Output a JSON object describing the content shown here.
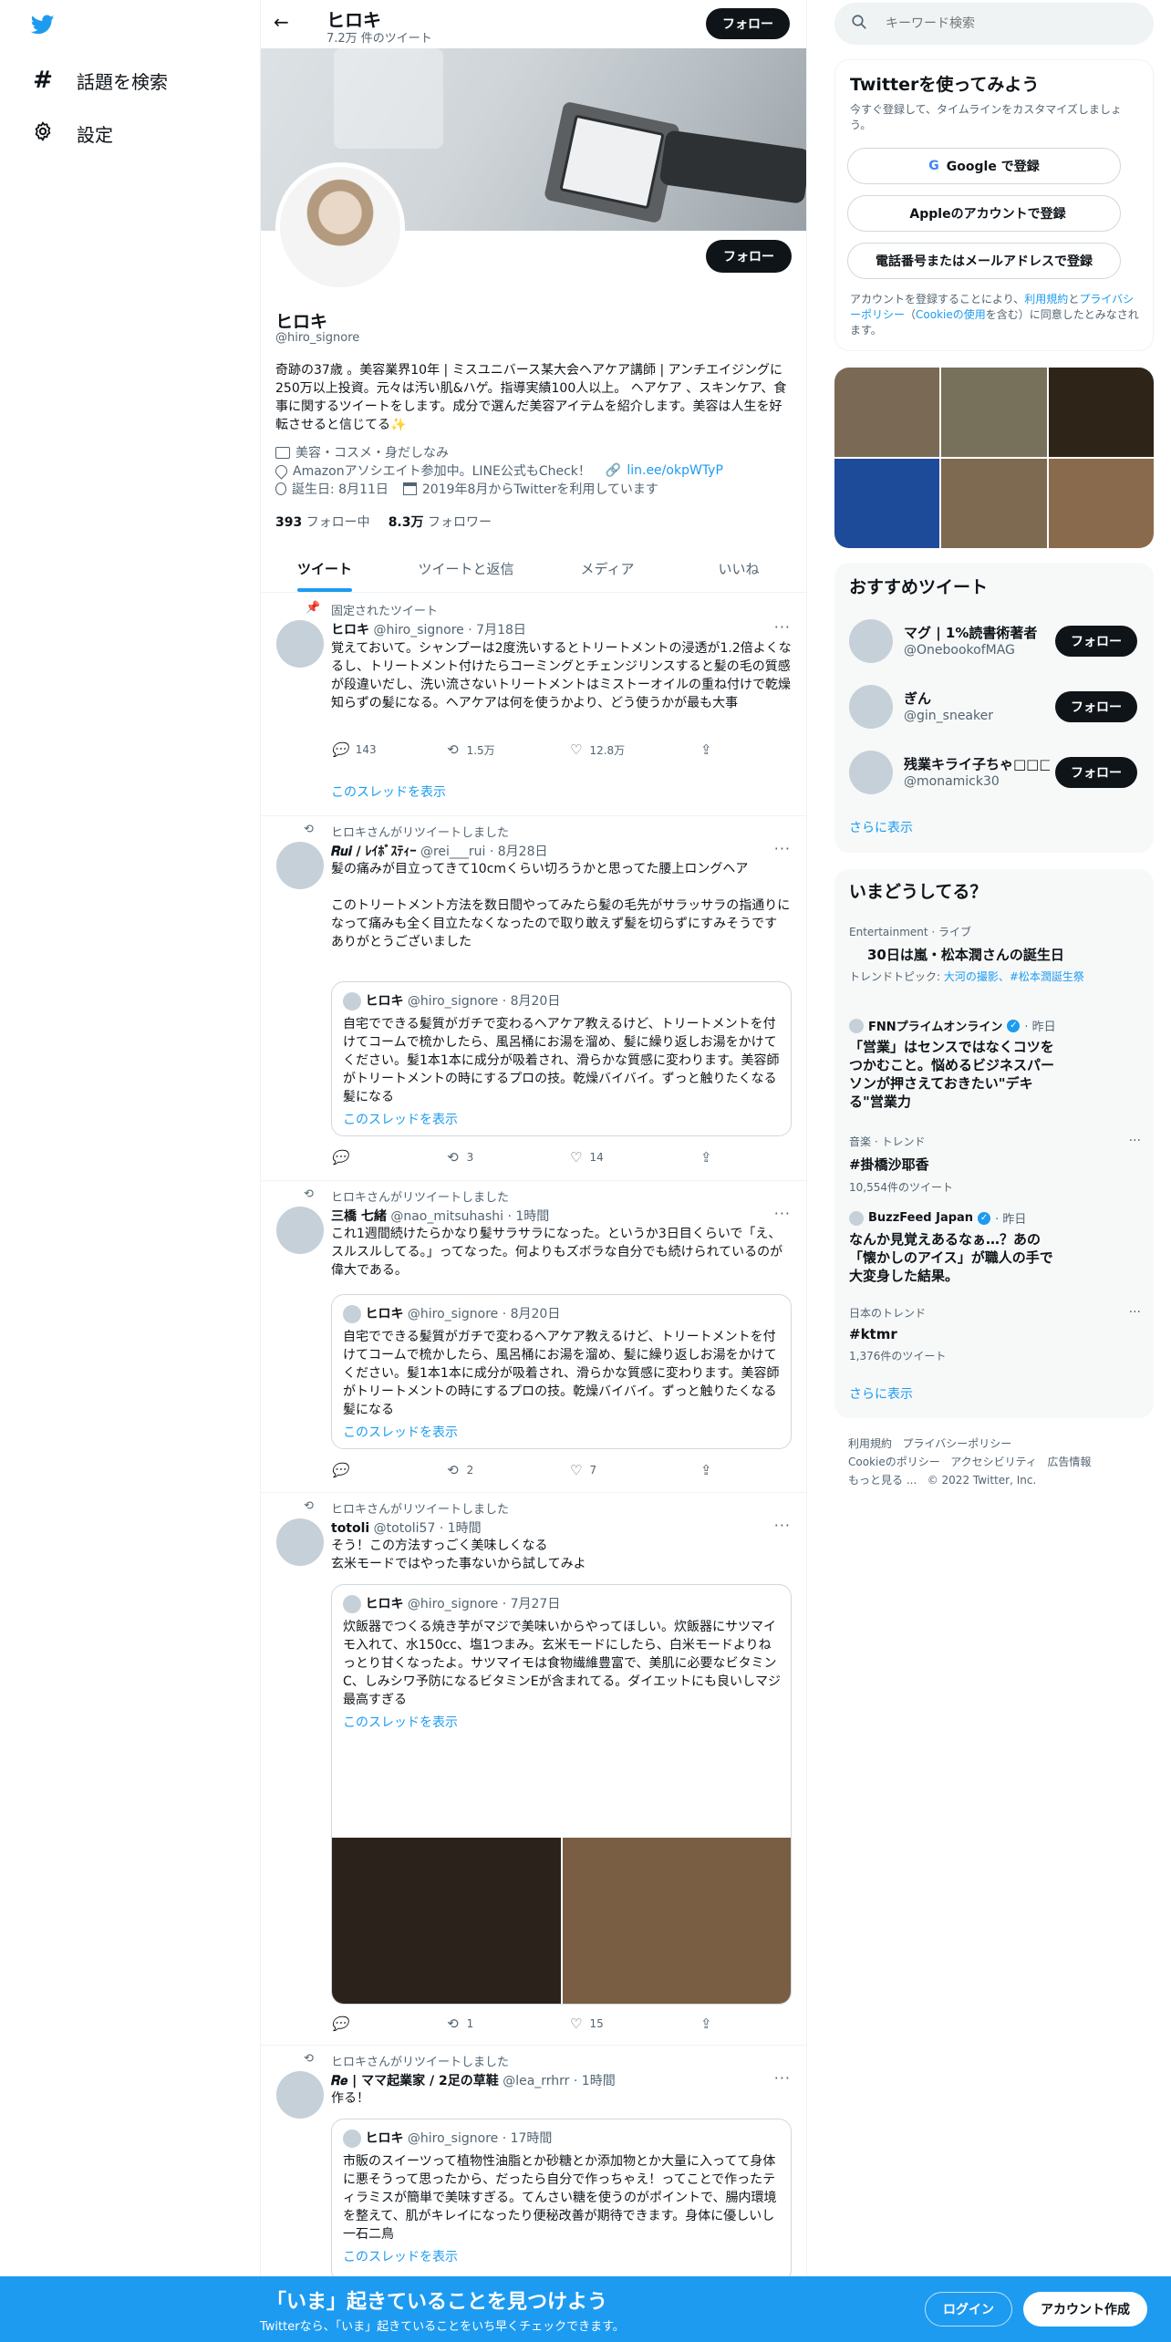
{
  "left_nav": {
    "explore_label": "話題を検索",
    "settings_label": "設定"
  },
  "header": {
    "name": "ヒロキ",
    "tweet_count": "7.2万 件のツイート",
    "follow_label": "フォロー"
  },
  "profile": {
    "name": "ヒロキ",
    "handle": "@hiro_signore",
    "follow_label": "フォロー",
    "bio": "奇跡の37歳 。美容業界10年 | ミスユニバース某大会ヘアケア講師 | アンチエイジングに250万以上投資。元々は汚い肌&ハゲ。指導実績100人以上。 ヘアケア 、スキンケア、食事に関するツイートをします。成分で選んだ美容アイテムを紹介します。美容は人生を好転させると信じてる✨",
    "category": "美容・コスメ・身だしなみ",
    "location": "Amazonアソシエイト参加中。LINE公式もCheck！",
    "url": "lin.ee/okpWTyP",
    "birthday": "誕生日: 8月11日",
    "joined": "2019年8月からTwitterを利用しています",
    "following_count": "393",
    "following_label": "フォロー中",
    "followers_count": "8.3万",
    "followers_label": "フォロワー"
  },
  "tabs": [
    {
      "label": "ツイート"
    },
    {
      "label": "ツイートと返信"
    },
    {
      "label": "メディア"
    },
    {
      "label": "いいね"
    }
  ],
  "tweets": [
    {
      "context": "固定されたツイート",
      "name": "ヒロキ",
      "handle": "@hiro_signore",
      "time": "· 7月18日",
      "text": "覚えておいて。シャンプーは2度洗いするとトリートメントの浸透が1.2倍よくなるし、トリートメント付けたらコーミングとチェンジリンスすると髪の毛の質感が段違いだし、洗い流さないトリートメントはミストーオイルの重ね付けで乾燥知らずの髪になる。ヘアケアは何を使うかより、どう使うかが最も大事",
      "replies": "143",
      "retweets": "1.5万",
      "likes": "12.8万",
      "thread_label": "このスレッドを表示"
    },
    {
      "context": "ヒロキさんがリツイートしました",
      "name": "𝑹𝒖𝒊 / ﾚｲﾎﾞｽﾃｨｰ",
      "handle": "@rei___rui",
      "time": "· 8月28日",
      "text": "髪の痛みが目立ってきて10cmくらい切ろうかと思ってた腰上ロングヘア\n\nこのトリートメント方法を数日間やってみたら髪の毛先がサラッサラの指通りになって痛みも全く目立たなくなったので取り敢えず髪を切らずにすみそうです\nありがとうございました",
      "quote_name": "ヒロキ",
      "quote_handle": "@hiro_signore",
      "quote_time": "· 8月20日",
      "quote_text": "自宅でできる髪質がガチで変わるヘアケア教えるけど、トリートメントを付けてコームで梳かしたら、風呂桶にお湯を溜め、髪に繰り返しお湯をかけてください。髪1本1本に成分が吸着され、滑らかな質感に変わります。美容師がトリートメントの時にするプロの技。乾燥バイバイ。ずっと触りたくなる髪になる",
      "quote_thread_label": "このスレッドを表示",
      "replies": "",
      "retweets": "3",
      "likes": "14"
    },
    {
      "context": "ヒロキさんがリツイートしました",
      "name": "三橋 七緒",
      "handle": "@nao_mitsuhashi",
      "time": "· 1時間",
      "text": "これ1週間続けたらかなり髪サラサラになった。というか3日目くらいで「え、スルスルしてる。」ってなった。何よりもズボラな自分でも続けられているのが偉大である。",
      "quote_name": "ヒロキ",
      "quote_handle": "@hiro_signore",
      "quote_time": "· 8月20日",
      "quote_text": "自宅でできる髪質がガチで変わるヘアケア教えるけど、トリートメントを付けてコームで梳かしたら、風呂桶にお湯を溜め、髪に繰り返しお湯をかけてください。髪1本1本に成分が吸着され、滑らかな質感に変わります。美容師がトリートメントの時にするプロの技。乾燥バイバイ。ずっと触りたくなる髪になる",
      "quote_thread_label": "このスレッドを表示",
      "replies": "",
      "retweets": "2",
      "likes": "7"
    },
    {
      "context": "ヒロキさんがリツイートしました",
      "name": "totoli",
      "handle": "@totoli57",
      "time": "· 1時間",
      "text": "そう！この方法すっごく美味しくなる\n玄米モードではやった事ないから試してみよ",
      "quote_name": "ヒロキ",
      "quote_handle": "@hiro_signore",
      "quote_time": "· 7月27日",
      "quote_text": "炊飯器でつくる焼き芋がマジで美味いからやってほしい。炊飯器にサツマイモ入れて、水150cc、塩1つまみ。玄米モードにしたら、白米モードよりねっとり甘くなったよ。サツマイモは食物繊維豊富で、美肌に必要なビタミンC、しみシワ予防になるビタミンEが含まれてる。ダイエットにも良いしマジ最高すぎる",
      "quote_thread_label": "このスレッドを表示",
      "replies": "",
      "retweets": "1",
      "likes": "15"
    },
    {
      "context": "ヒロキさんがリツイートしました",
      "name": "𝑹𝒆 | ママ起業家 / 2足の草鞋",
      "handle": "@lea_rrhrr",
      "time": "· 1時間",
      "text": "作る！",
      "quote_name": "ヒロキ",
      "quote_handle": "@hiro_signore",
      "quote_time": "· 17時間",
      "quote_text": "市販のスイーツって植物性油脂とか砂糖とか添加物とか大量に入ってて身体に悪そうって思ったから、だったら自分で作っちゃえ！ってことで作ったティラミスが簡単で美味すぎる。てんさい糖を使うのがポイントで、腸内環境を整えて、肌がキレイになったり便秘改善が期待できます。身体に優しいし一石二鳥",
      "quote_thread_label": "このスレッドを表示"
    }
  ],
  "search": {
    "placeholder": "キーワード検索"
  },
  "signup": {
    "title": "Twitterを使ってみよう",
    "subtitle": "今すぐ登録して、タイムラインをカスタマイズしましょう。",
    "google_label": "Google で登録",
    "apple_label": "Appleのアカウントで登録",
    "phone_label": "電話番号またはメールアドレスで登録",
    "legal_prefix": "アカウントを登録することにより、",
    "legal_terms": "利用規約",
    "legal_and": "と",
    "legal_privacy": "プライバシーポリシー",
    "legal_paren_open": "（",
    "legal_cookie": "Cookieの使用",
    "legal_suffix": "を含む）に同意したとみなされます。"
  },
  "recommended": {
    "title": "おすすめツイート",
    "users": [
      {
        "name": "マグ | 1%読書術著者",
        "handle": "@OnebookofMAG",
        "follow_label": "フォロー"
      },
      {
        "name": "ぎん",
        "handle": "@gin_sneaker",
        "follow_label": "フォロー"
      },
      {
        "name": "残業キライ子ちゃ□□□□",
        "handle": "@monamick30",
        "follow_label": "フォロー"
      }
    ],
    "more_label": "さらに表示"
  },
  "trends": {
    "title": "いまどうしてる？",
    "t1_meta": "Entertainment · ライブ",
    "t1_title": "30日は嵐・松本潤さんの誕生日",
    "t1_topic_prefix": "トレンドトピック: ",
    "t1_topic": "大河の撮影、#松本潤誕生祭",
    "t2_source": "FNNプライムオンライン",
    "t2_time": "· 昨日",
    "t2_title": "「営業」はセンスではなくコツをつかむこと。悩めるビジネスパーソンが押さえておきたい\"デキる\"営業力",
    "t3_meta": "音楽 · トレンド",
    "t3_title": "#掛橋沙耶香",
    "t3_count": "10,554件のツイート",
    "t4_source": "BuzzFeed Japan",
    "t4_time": "· 昨日",
    "t4_title": "なんか見覚えあるなぁ…？あの「懐かしのアイス」が職人の手で大変身した結果。",
    "t5_meta": "日本のトレンド",
    "t5_title": "#ktmr",
    "t5_count": "1,376件のツイート",
    "more_label": "さらに表示"
  },
  "footer": {
    "terms": "利用規約",
    "privacy": "プライバシーポリシー",
    "cookie": "Cookieのポリシー",
    "accessibility": "アクセシビリティ",
    "ads": "広告情報",
    "more": "もっと見る ...",
    "copyright": "© 2022 Twitter, Inc."
  },
  "bottom_bar": {
    "title": "「いま」起きていることを見つけよう",
    "subtitle": "Twitterなら、「いま」起きていることをいち早くチェックできます。",
    "login_label": "ログイン",
    "signup_label": "アカウント作成"
  },
  "colors": {
    "accent": "#1d9bf0",
    "text": "#0f1419",
    "muted": "#536471",
    "bottom_bar": "#1d9bf0"
  },
  "media_colors": [
    "#7a6a55",
    "#77705a",
    "#2f2418",
    "#1e4a9a",
    "#7d6a50",
    "#8a6a4c"
  ]
}
